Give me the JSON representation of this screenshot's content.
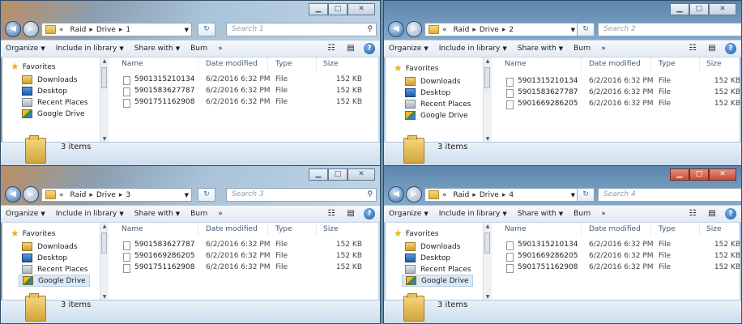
{
  "toolbar": {
    "organize": "Organize",
    "include": "Include in library",
    "share": "Share with",
    "burn": "Burn",
    "more": "»"
  },
  "columns": {
    "name": "Name",
    "date": "Date modified",
    "type": "Type",
    "size": "Size"
  },
  "nav": {
    "favorites": "Favorites",
    "downloads": "Downloads",
    "desktop": "Desktop",
    "recent": "Recent Places",
    "gdrive": "Google Drive"
  },
  "windows": [
    {
      "breadcrumb": [
        "«",
        "Raid",
        "Drive",
        "1"
      ],
      "search_placeholder": "Search 1",
      "item_count": "3 items",
      "files": [
        {
          "name": "5901315210134",
          "date": "6/2/2016 6:32 PM",
          "type": "File",
          "size": "152 KB"
        },
        {
          "name": "5901583627787",
          "date": "6/2/2016 6:32 PM",
          "type": "File",
          "size": "152 KB"
        },
        {
          "name": "5901751162908",
          "date": "6/2/2016 6:32 PM",
          "type": "File",
          "size": "152 KB"
        }
      ]
    },
    {
      "breadcrumb": [
        "«",
        "Raid",
        "Drive",
        "2"
      ],
      "search_placeholder": "Search 2",
      "item_count": "3 items",
      "files": [
        {
          "name": "5901315210134",
          "date": "6/2/2016 6:32 PM",
          "type": "File",
          "size": "152 KB"
        },
        {
          "name": "5901583627787",
          "date": "6/2/2016 6:32 PM",
          "type": "File",
          "size": "152 KB"
        },
        {
          "name": "5901669286205",
          "date": "6/2/2016 6:32 PM",
          "type": "File",
          "size": "152 KB"
        }
      ]
    },
    {
      "breadcrumb": [
        "«",
        "Raid",
        "Drive",
        "3"
      ],
      "search_placeholder": "Search 3",
      "item_count": "3 items",
      "files": [
        {
          "name": "5901583627787",
          "date": "6/2/2016 6:32 PM",
          "type": "File",
          "size": "152 KB"
        },
        {
          "name": "5901669286205",
          "date": "6/2/2016 6:32 PM",
          "type": "File",
          "size": "152 KB"
        },
        {
          "name": "5901751162908",
          "date": "6/2/2016 6:32 PM",
          "type": "File",
          "size": "152 KB"
        }
      ]
    },
    {
      "breadcrumb": [
        "«",
        "Raid",
        "Drive",
        "4"
      ],
      "search_placeholder": "Search 4",
      "item_count": "3 items",
      "files": [
        {
          "name": "5901315210134",
          "date": "6/2/2016 6:32 PM",
          "type": "File",
          "size": "152 KB"
        },
        {
          "name": "5901669286205",
          "date": "6/2/2016 6:32 PM",
          "type": "File",
          "size": "152 KB"
        },
        {
          "name": "5901751162908",
          "date": "6/2/2016 6:32 PM",
          "type": "File",
          "size": "152 KB"
        }
      ]
    }
  ]
}
